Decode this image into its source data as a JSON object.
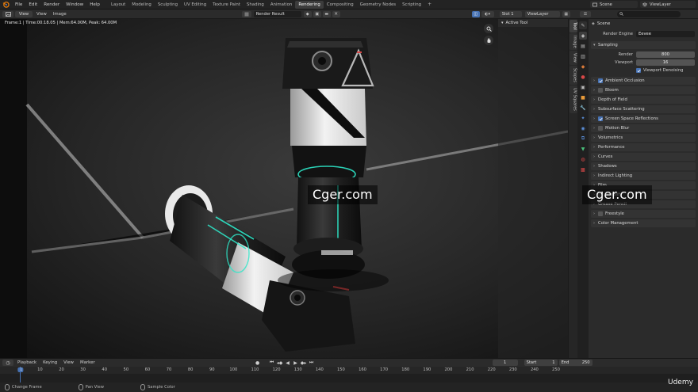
{
  "topbar": {
    "menus": [
      "File",
      "Edit",
      "Render",
      "Window",
      "Help"
    ],
    "workspaces": [
      "Layout",
      "Modeling",
      "Sculpting",
      "UV Editing",
      "Texture Paint",
      "Shading",
      "Animation",
      "Rendering",
      "Compositing",
      "Geometry Nodes",
      "Scripting"
    ],
    "active_workspace": "Rendering",
    "scene": "Scene",
    "view_layer": "ViewLayer"
  },
  "viewport_header": {
    "view": "View",
    "view2": "View",
    "image": "Image",
    "image_name": "Render Result",
    "slot": "Slot 1",
    "layer": "ViewLayer"
  },
  "viewport": {
    "frame_info": "Frame:1 | Time:00:18.05 | Mem:64.00M, Peak: 64.00M",
    "active_tool": "Active Tool",
    "watermark": "Cger.com"
  },
  "side_tabs": [
    "Tool",
    "Image",
    "View",
    "Scopes",
    "UV Squares"
  ],
  "properties": {
    "breadcrumb": "Scene",
    "render_engine_label": "Render Engine",
    "render_engine": "Eevee",
    "sampling": "Sampling",
    "render_label": "Render",
    "render_value": "800",
    "viewport_label": "Viewport",
    "viewport_value": "16",
    "viewport_denoising": "Viewport Denoising",
    "sections": [
      {
        "label": "Ambient Occlusion",
        "checkbox": true,
        "on": true
      },
      {
        "label": "Bloom",
        "checkbox": true,
        "on": false
      },
      {
        "label": "Depth of Field",
        "checkbox": false,
        "on": false
      },
      {
        "label": "Subsurface Scattering",
        "checkbox": false,
        "on": false
      },
      {
        "label": "Screen Space Reflections",
        "checkbox": true,
        "on": true
      },
      {
        "label": "Motion Blur",
        "checkbox": true,
        "on": false
      },
      {
        "label": "Volumetrics",
        "checkbox": false,
        "on": false
      },
      {
        "label": "Performance",
        "checkbox": false,
        "on": false
      },
      {
        "label": "Curves",
        "checkbox": false,
        "on": false
      },
      {
        "label": "Shadows",
        "checkbox": false,
        "on": false
      },
      {
        "label": "Indirect Lighting",
        "checkbox": false,
        "on": false
      },
      {
        "label": "Film",
        "checkbox": false,
        "on": false
      },
      {
        "label": "Simplify",
        "checkbox": true,
        "on": false
      },
      {
        "label": "Grease Pencil",
        "checkbox": false,
        "on": false
      },
      {
        "label": "Freestyle",
        "checkbox": true,
        "on": false
      },
      {
        "label": "Color Management",
        "checkbox": false,
        "on": false
      }
    ]
  },
  "timeline": {
    "playback": "Playback",
    "keying": "Keying",
    "view": "View",
    "marker": "Marker",
    "current_frame": "1",
    "start_label": "Start",
    "start": "1",
    "end_label": "End",
    "end": "250",
    "ticks": [
      "1",
      "10",
      "20",
      "30",
      "40",
      "50",
      "60",
      "70",
      "80",
      "90",
      "100",
      "110",
      "120",
      "130",
      "140",
      "150",
      "160",
      "170",
      "180",
      "190",
      "200",
      "210",
      "220",
      "230",
      "240",
      "250"
    ]
  },
  "status": {
    "change_frame": "Change Frame",
    "pan_view": "Pan View",
    "sample_color": "Sample Color",
    "brand": "Udemy"
  },
  "colors": {
    "accent": "#4772b3",
    "glow": "#2ee6c8",
    "active_tab": "#3c3c3c"
  }
}
